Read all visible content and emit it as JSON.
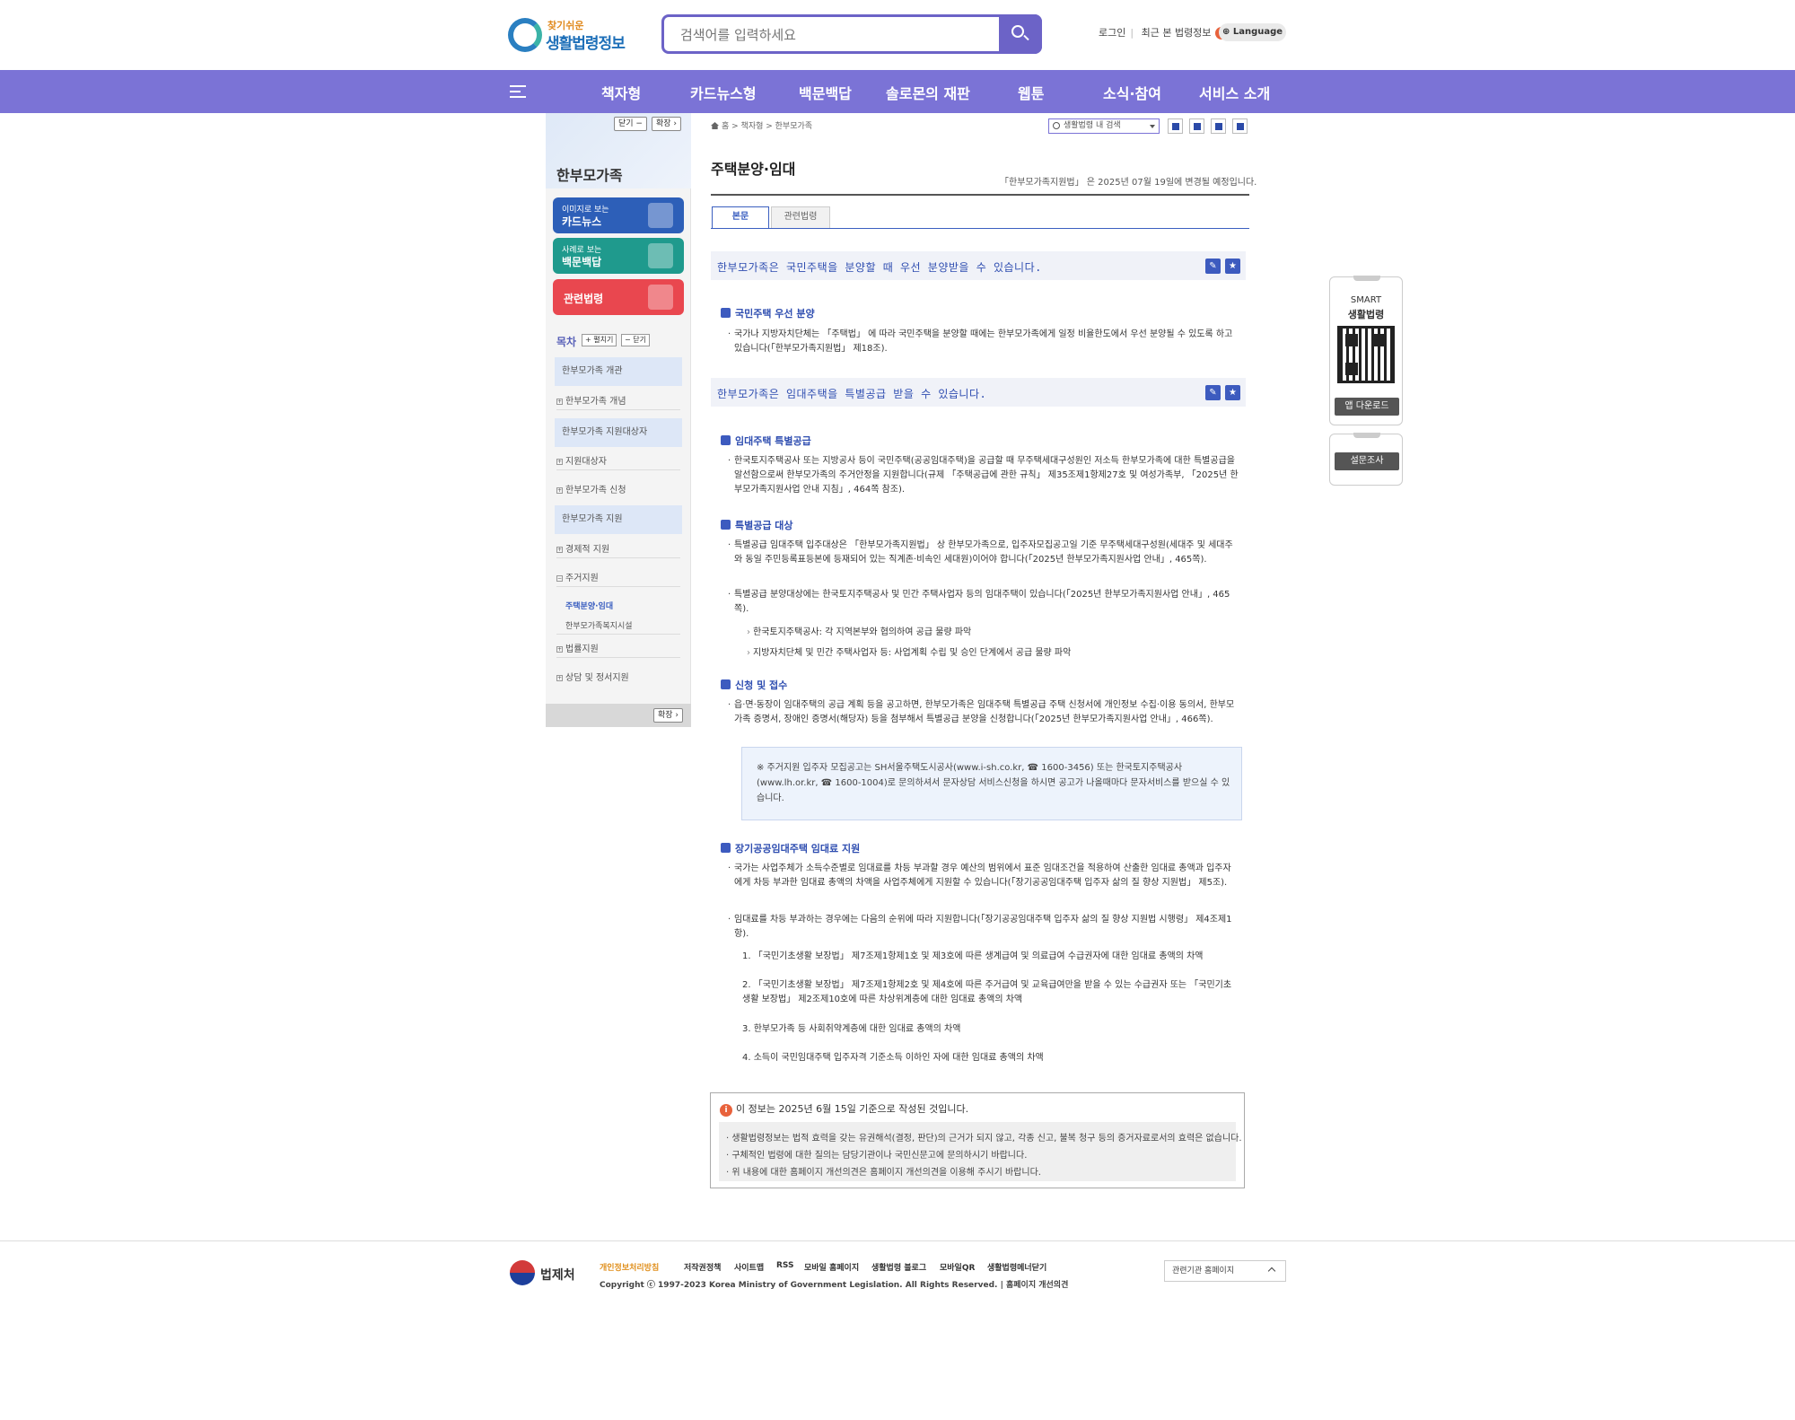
{
  "header": {
    "logo_small": "찾기쉬운",
    "logo_big": "생활법령정보",
    "search_placeholder": "검색어를 입력하세요",
    "login": "로그인",
    "recent": "최근 본 법령정보",
    "recent_count": "-",
    "language": "Language"
  },
  "gnb": [
    "책자형",
    "카드뉴스형",
    "백문백답",
    "솔로몬의 재판",
    "웹툰",
    "소식·참여",
    "서비스 소개"
  ],
  "lnb": {
    "close_btn": "닫기 −",
    "expand_btn": "확장 ›",
    "title": "한부모가족",
    "cards": [
      {
        "sub": "이미지로 보는",
        "label": "카드뉴스",
        "color": "#2d5fb8"
      },
      {
        "sub": "사례로 보는",
        "label": "백문백답",
        "color": "#1f9a8d"
      },
      {
        "label": "관련법령",
        "color": "#e9474f"
      }
    ],
    "toc_title": "목차",
    "toc_open": "+ 펼치기",
    "toc_close": "− 닫기",
    "toc": {
      "sec1": "한부모가족 개관",
      "item1": "한부모가족 개념",
      "sec2": "한부모가족 지원대상자",
      "item2": "지원대상자",
      "item3": "한부모가족 신청",
      "sec3": "한부모가족 지원",
      "item4": "경제적 지원",
      "item5": "주거지원",
      "sub1": "주택분양·임대",
      "sub2": "한부모가족복지시설",
      "item6": "법률지원",
      "item7": "상담 및 정서지원"
    },
    "bottom_expand": "확장 ›"
  },
  "main": {
    "breadcrumb": "홈 > 책자형 > 한부모가족",
    "law_search": "생활법령 내 검색",
    "title": "주택분양·임대",
    "update_note": "「한부모가족지원법」 은 2025년 07월 19일에 변경될 예정입니다.",
    "tab_main": "본문",
    "tab_related": "관련법령",
    "q1": "한부모가족은 국민주택을 분양할 때 우선 분양받을 수 있습니다.",
    "h1": "국민주택 우선 분양",
    "p1": "국가나 지방자치단체는 「주택법」 에 따라 국민주택을 분양할 때에는 한부모가족에게 일정 비율한도에서 우선 분양될 수 있도록 하고 있습니다(「한부모가족지원법」 제18조).",
    "q2": "한부모가족은 임대주택을 특별공급 받을 수 있습니다.",
    "h2": "임대주택 특별공급",
    "p2": "한국토지주택공사 또는 지방공사 등이 국민주택(공공임대주택)을 공급할 때 무주택세대구성원인 저소득 한부모가족에 대한 특별공급을 알선함으로써 한부모가족의 주거안정을 지원합니다(규제 「주택공급에 관한 규칙」 제35조제1항제27호 및 여성가족부, 「2025년 한부모가족지원사업 안내 지침」, 464쪽 참조).",
    "h3": "특별공급 대상",
    "p3": "특별공급 임대주택 입주대상은 「한부모가족지원법」 상 한부모가족으로, 입주자모집공고일 기준 무주택세대구성원(세대주 및 세대주와 동일 주민등록표등본에 등재되어 있는 직계존·비속인 세대원)이어야 합니다(「2025년 한부모가족지원사업 안내」, 465쪽).",
    "p4": "특별공급 분양대상에는 한국토지주택공사 및 민간 주택사업자 등의 임대주택이 있습니다(「2025년 한부모가족지원사업 안내」, 465쪽).",
    "a1": "한국토지주택공사: 각 지역본부와 협의하여 공급 물량 파악",
    "a2": "지방자치단체 및 민간 주택사업자 등: 사업계획 수립 및 승인 단계에서 공급 물량 파악",
    "h4": "신청 및 접수",
    "p5": "읍·면·동장이 임대주택의 공급 계획 등을 공고하면, 한부모가족은 임대주택 특별공급 주택 신청서에 개인정보 수집·이용 동의서, 한부모가족 증명서, 장애인 증명서(해당자) 등을 첨부해서 특별공급 분양을 신청합니다(「2025년 한부모가족지원사업 안내」, 466쪽).",
    "notice": "※ 주거지원 입주자 모집공고는 SH서울주택도시공사(www.i-sh.co.kr, ☎ 1600-3456) 또는 한국토지주택공사(www.lh.or.kr, ☎ 1600-1004)로 문의하셔서 문자상담 서비스신청을 하시면 공고가 나올때마다 문자서비스를 받으실 수 있습니다.",
    "h5": "장기공공임대주택 임대료 지원",
    "p6": "국가는 사업주체가 소득수준별로 임대료를 차등 부과할 경우 예산의 범위에서 표준 임대조건을 적용하여 산출한 임대료 총액과 입주자에게 차등 부과한 임대료 총액의 차액을 사업주체에게 지원할 수 있습니다(「장기공공임대주택 입주자 삶의 질 향상 지원법」 제5조).",
    "p7": "임대료를 차등 부과하는 경우에는 다음의 순위에 따라 지원합니다(「장기공공임대주택 입주자 삶의 질 향상 지원법 시행령」 제4조제1항).",
    "n1": "1. 「국민기초생활 보장법」 제7조제1항제1호 및 제3호에 따른 생계급여 및 의료급여 수급권자에 대한 임대료 총액의 차액",
    "n2": "2. 「국민기초생활 보장법」 제7조제1항제2호 및 제4호에 따른 주거급여 및 교육급여만을 받을 수 있는 수급권자 또는 「국민기초생활 보장법」 제2조제10호에 따른 차상위계층에 대한 임대료 총액의 차액",
    "n3": "3. 한부모가족 등 사회취약계층에 대한 임대료 총액의 차액",
    "n4": "4. 소득이 국민임대주택 입주자격 기준소득 이하인 자에 대한 임대료 총액의 차액",
    "info_head": "이 정보는 2025년 6월 15일 기준으로 작성된 것입니다.",
    "info1": "· 생활법령정보는 법적 효력을 갖는 유권해석(결정, 판단)의 근거가 되지 않고, 각종 신고, 불복 청구 등의 증거자료로서의 효력은 없습니다.",
    "info2": "· 구체적인 법령에 대한 질의는 담당기관이나 국민신문고에 문의하시기 바랍니다.",
    "info3": "· 위 내용에 대한 홈페이지 개선의견은 홈페이지 개선의견을 이용해 주시기 바랍니다."
  },
  "float": {
    "smart1": "SMART",
    "smart2": "생활법령",
    "app_download": "앱 다운로드",
    "survey": "설문조사"
  },
  "footer": {
    "org": "법제처",
    "links": [
      "개인정보처리방침",
      "저작권정책",
      "사이트맵",
      "RSS",
      "모바일 홈페이지",
      "생활법령 블로그",
      "모바일QR",
      "생활법령메너닫기"
    ],
    "copyright": "Copyright ⓒ 1997-2023 Korea Ministry of Government Legislation. All Rights Reserved.   |   홈페이지 개선의견",
    "related_sites": "관련기관 홈페이지"
  }
}
